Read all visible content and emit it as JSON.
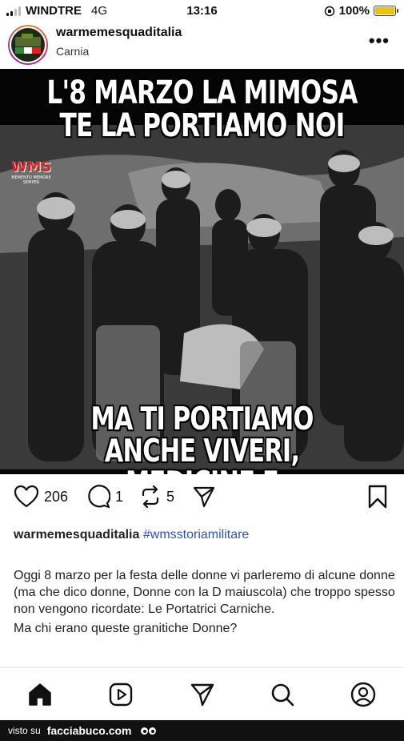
{
  "status_bar": {
    "carrier": "WINDTRE",
    "network": "4G",
    "time": "13:16",
    "battery": "100%",
    "battery_level": 1.0,
    "battery_color": "#f2c200"
  },
  "post": {
    "username": "warmemesquaditalia",
    "location": "Carnia",
    "more_icon": "more-horizontal-icon",
    "image": {
      "top_text": "L'8 MARZO LA MIMOSA TE LA PORTIAMO NOI",
      "bottom_text": "MA TI PORTIAMO ANCHE VIVERI, MEDICINE E MUNIZIONI!",
      "logo_letters": "WMS",
      "logo_subtitle": "MEMENTO MEMORE SEMPER"
    },
    "actions": {
      "likes": "206",
      "comments": "1",
      "reposts": "5"
    },
    "caption": {
      "user": "warmemesquaditalia",
      "hashtag": "#wmsstoriamilitare",
      "paragraph_1": "Oggi 8 marzo per la festa delle donne vi parleremo di alcune donne (ma che dico donne, Donne con la D maiuscola) che troppo spesso non vengono ricordate: Le Portatrici Carniche.",
      "paragraph_2": "Ma chi erano queste granitiche Donne?"
    }
  },
  "bottom_nav": {
    "items": [
      "home-icon",
      "reels-icon",
      "send-icon",
      "search-icon",
      "profile-icon"
    ]
  },
  "watermark": {
    "prefix": "visto su",
    "brand": "facciabuco.com"
  },
  "colors": {
    "hashtag": "#2b50c8",
    "ring": "#dd2a7b"
  }
}
